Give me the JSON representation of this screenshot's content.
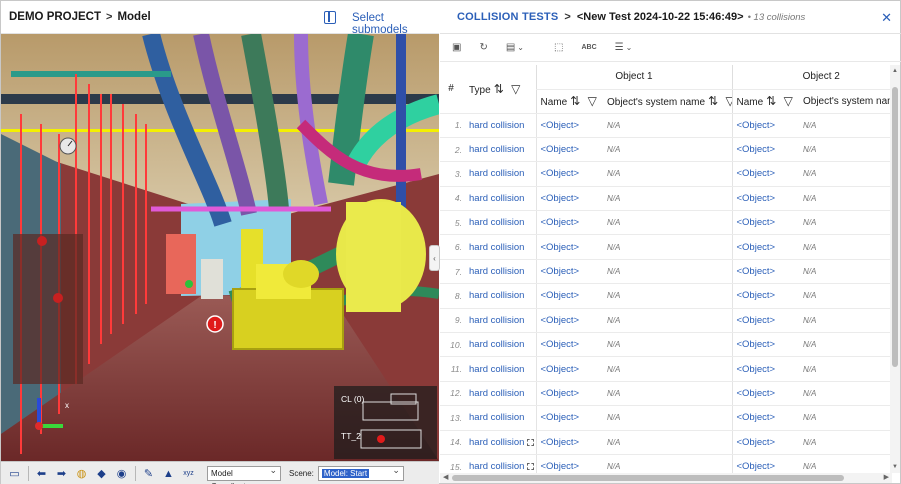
{
  "colors": {
    "accent": "#2b5fb8",
    "muted_text": "#777777",
    "clash_marker": "#e01b1b"
  },
  "left": {
    "breadcrumb": {
      "project": "DEMO PROJECT",
      "separator": ">",
      "page": "Model"
    },
    "panel_icon": "split-panel-icon",
    "select_submodels_label": "Select submodels",
    "viewport": {
      "minimap_labels": [
        "CL (0)",
        "TT_2"
      ],
      "axis_label": "x"
    },
    "toolbar": {
      "icons": [
        "window-icon",
        "arrow-left-icon",
        "arrow-right-icon",
        "orbit-icon",
        "cube-icon",
        "camera-icon",
        "hammer-icon",
        "car-icon",
        "xyz-icon"
      ],
      "coordinates_value": "Model Coordinates",
      "scene_label": "Scene:",
      "scene_value": "Model: Start"
    }
  },
  "right": {
    "header": {
      "title": "COLLISION TESTS",
      "separator": ">",
      "test_name": "<New Test 2024-10-22 15:46:49>",
      "count_text": "• 13 collisions"
    },
    "toolbar_icons": [
      "save-icon",
      "refresh-icon",
      "export-icon",
      "select-box-icon",
      "abc-icon",
      "list-icon"
    ],
    "table": {
      "group_headers": [
        "Object 1",
        "Object 2"
      ],
      "col_num": "#",
      "col_type": "Type",
      "col_name": "Name",
      "col_system": "Object's system name",
      "rows": [
        {
          "num": "1.",
          "type": "hard collision",
          "name1": "<Object>",
          "sys1": "N/A",
          "name2": "<Object>",
          "sys2": "N/A"
        },
        {
          "num": "2.",
          "type": "hard collision",
          "name1": "<Object>",
          "sys1": "N/A",
          "name2": "<Object>",
          "sys2": "N/A"
        },
        {
          "num": "3.",
          "type": "hard collision",
          "name1": "<Object>",
          "sys1": "N/A",
          "name2": "<Object>",
          "sys2": "N/A"
        },
        {
          "num": "4.",
          "type": "hard collision",
          "name1": "<Object>",
          "sys1": "N/A",
          "name2": "<Object>",
          "sys2": "N/A"
        },
        {
          "num": "5.",
          "type": "hard collision",
          "name1": "<Object>",
          "sys1": "N/A",
          "name2": "<Object>",
          "sys2": "N/A"
        },
        {
          "num": "6.",
          "type": "hard collision",
          "name1": "<Object>",
          "sys1": "N/A",
          "name2": "<Object>",
          "sys2": "N/A"
        },
        {
          "num": "7.",
          "type": "hard collision",
          "name1": "<Object>",
          "sys1": "N/A",
          "name2": "<Object>",
          "sys2": "N/A"
        },
        {
          "num": "8.",
          "type": "hard collision",
          "name1": "<Object>",
          "sys1": "N/A",
          "name2": "<Object>",
          "sys2": "N/A"
        },
        {
          "num": "9.",
          "type": "hard collision",
          "name1": "<Object>",
          "sys1": "N/A",
          "name2": "<Object>",
          "sys2": "N/A"
        },
        {
          "num": "10.",
          "type": "hard collision",
          "name1": "<Object>",
          "sys1": "N/A",
          "name2": "<Object>",
          "sys2": "N/A"
        },
        {
          "num": "11.",
          "type": "hard collision",
          "name1": "<Object>",
          "sys1": "N/A",
          "name2": "<Object>",
          "sys2": "N/A"
        },
        {
          "num": "12.",
          "type": "hard collision",
          "name1": "<Object>",
          "sys1": "N/A",
          "name2": "<Object>",
          "sys2": "N/A"
        },
        {
          "num": "13.",
          "type": "hard collision",
          "name1": "<Object>",
          "sys1": "N/A",
          "name2": "<Object>",
          "sys2": "N/A"
        },
        {
          "num": "14.",
          "type": "hard collision",
          "badge": true,
          "name1": "<Object>",
          "sys1": "N/A",
          "name2": "<Object>",
          "sys2": "N/A"
        },
        {
          "num": "15.",
          "type": "hard collision",
          "badge": true,
          "name1": "<Object>",
          "sys1": "N/A",
          "name2": "<Object>",
          "sys2": "N/A"
        }
      ]
    }
  }
}
